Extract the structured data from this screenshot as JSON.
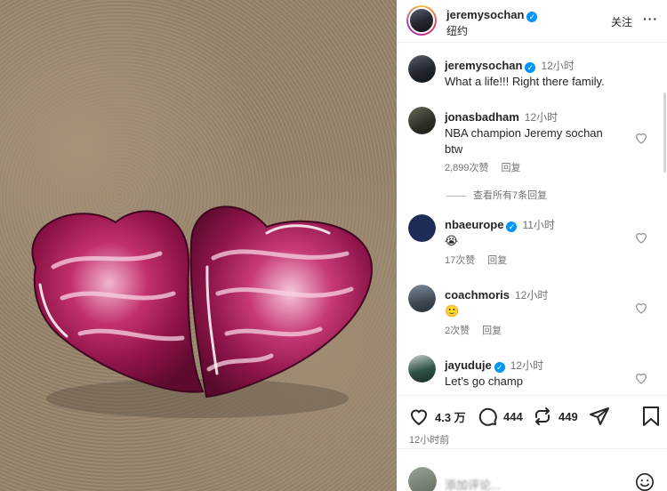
{
  "post": {
    "username": "jeremysochan",
    "location": "纽约",
    "follow_label": "关注",
    "more_label": "···"
  },
  "caption": {
    "username": "jeremysochan",
    "time": "12小时",
    "text": "What a life!!! Right there family."
  },
  "comments": [
    {
      "username": "jonasbadham",
      "verified": false,
      "time": "12小时",
      "text": "NBA champion Jeremy sochan btw",
      "likes": "2,899次赞",
      "reply": "回复",
      "view_replies": "查看所有7条回复"
    },
    {
      "username": "nbaeurope",
      "verified": true,
      "time": "11小时",
      "text": "😭",
      "likes": "17次赞",
      "reply": "回复"
    },
    {
      "username": "coachmoris",
      "verified": false,
      "time": "12小时",
      "text": "🙂",
      "likes": "2次赞",
      "reply": "回复"
    },
    {
      "username": "jayuduje",
      "verified": true,
      "time": "12小时",
      "text": "Let’s go champ"
    }
  ],
  "actions": {
    "likes": "4.3 万",
    "comments": "444",
    "reposts": "449",
    "posted": "12小时前"
  },
  "composer": {
    "placeholder": "添加评论..."
  },
  "icons": [
    "heart-icon",
    "comment-icon",
    "repost-icon",
    "share-icon",
    "bookmark-icon",
    "emoji-icon",
    "verified-badge-icon"
  ],
  "colors": {
    "verified": "#0095f6",
    "muted": "#737373",
    "text": "#262626"
  }
}
